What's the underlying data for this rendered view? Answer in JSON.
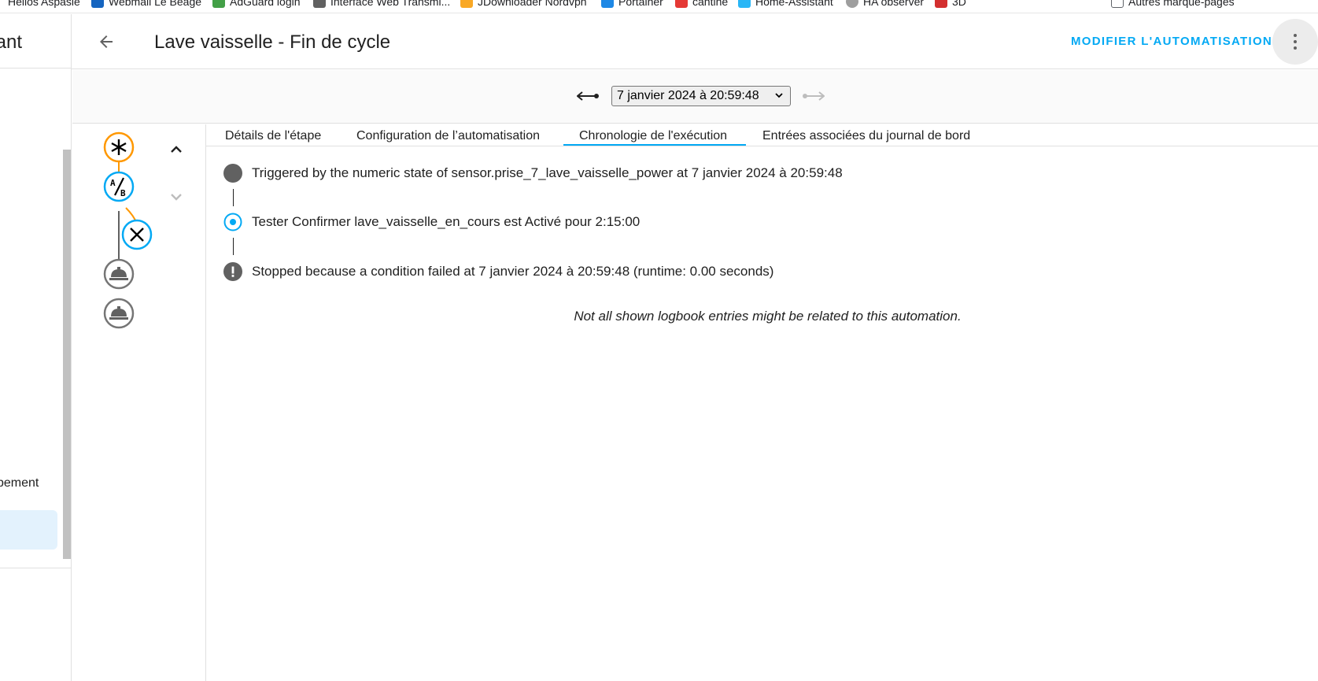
{
  "bookmarks": [
    {
      "label": "Helios Aspasie",
      "color": "#ffffff"
    },
    {
      "label": "Webmail Le Beage",
      "color": "#1565c0"
    },
    {
      "label": "AdGuard login",
      "color": "#43a047"
    },
    {
      "label": "Interface Web Transmi...",
      "color": "#616161"
    },
    {
      "label": "JDownloader Nordvpn",
      "color": "#f9a825"
    },
    {
      "label": "Portainer",
      "color": "#1e88e5"
    },
    {
      "label": "cantine",
      "color": "#e53935"
    },
    {
      "label": "Home-Assistant",
      "color": "#29b6f6"
    },
    {
      "label": "HA observer",
      "color": "#616161"
    },
    {
      "label": "3D",
      "color": "#d32f2f"
    },
    {
      "label": "Autres marque-pages",
      "color": "#ffffff"
    }
  ],
  "sidebar": {
    "title": "tant",
    "item_label": "pement"
  },
  "header": {
    "title": "Lave vaisselle - Fin de cycle",
    "edit_label": "MODIFIER L'AUTOMATISATION"
  },
  "trace": {
    "selected_run": "7 janvier 2024 à 20:59:48"
  },
  "tabs": [
    {
      "label": "Détails de l'étape",
      "active": false
    },
    {
      "label": "Configuration de l’automatisation",
      "active": false
    },
    {
      "label": "Chronologie de l'exécution",
      "active": true
    },
    {
      "label": "Entrées associées du journal de bord",
      "active": false
    }
  ],
  "timeline": {
    "entries": [
      {
        "type": "trigger",
        "text": "Triggered by the numeric state of sensor.prise_7_lave_vaisselle_power at 7 janvier 2024 à 20:59:48"
      },
      {
        "type": "condition",
        "text": "Tester Confirmer lave_vaisselle_en_cours est Activé pour 2:15:00"
      },
      {
        "type": "stopped",
        "text": "Stopped because a condition failed at 7 janvier 2024 à 20:59:48 (runtime: 0.00 seconds)"
      }
    ],
    "note": "Not all shown logbook entries might be related to this automation."
  },
  "colors": {
    "accent": "#03a9f4",
    "trigger": "#ff9800",
    "active_path": "#03a9f4",
    "inactive": "#757575"
  },
  "icons": {
    "back": "arrow-left-icon",
    "more": "dots-vertical-icon",
    "older": "arrow-left-right-icon",
    "newer": "arrow-left-right-icon",
    "graph_nodes": [
      "asterisk-icon",
      "ab-testing-icon",
      "close-icon",
      "room-service-icon",
      "room-service-icon"
    ]
  }
}
